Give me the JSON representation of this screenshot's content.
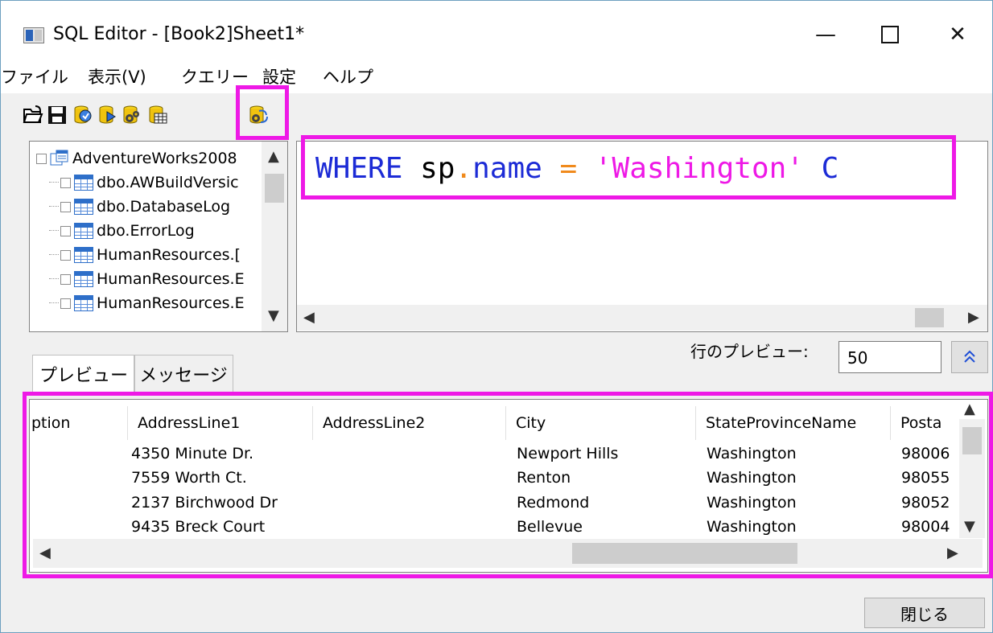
{
  "window": {
    "title": "SQL Editor - [Book2]Sheet1*",
    "minimize_glyph": "—",
    "close_glyph": "✕"
  },
  "menu": [
    "ファイル",
    "表示(V)",
    "クエリー",
    "設定",
    "ヘルプ"
  ],
  "toolbar": {
    "icons": [
      "open-folder-icon",
      "save-icon",
      "query-cylinder-icon",
      "run-query-cylinder-icon",
      "gears-cylinder-icon",
      "table-cylinder-icon",
      "wizard-cylinder-icon"
    ],
    "highlighted_index": 6
  },
  "tree": {
    "root": "AdventureWorks2008",
    "items": [
      "dbo.AWBuildVersic",
      "dbo.DatabaseLog",
      "dbo.ErrorLog",
      "HumanResources.[",
      "HumanResources.E",
      "HumanResources.E"
    ]
  },
  "editor": {
    "keyword": "WHERE",
    "alias": "sp",
    "dot": ".",
    "field": "name",
    "equals": "=",
    "string": "'Washington'",
    "trailing": "C"
  },
  "preview": {
    "label": "行のプレビュー:",
    "rows_value": "50",
    "collapse_glyph": "≈"
  },
  "tabs": [
    "プレビュー",
    "メッセージ"
  ],
  "grid": {
    "columns": [
      "ption",
      "AddressLine1",
      "AddressLine2",
      "City",
      "StateProvinceName",
      "Posta"
    ],
    "rows": [
      [
        "",
        "4350 Minute Dr.",
        "",
        "Newport Hills",
        "Washington",
        "98006"
      ],
      [
        "",
        "7559 Worth Ct.",
        "",
        "Renton",
        "Washington",
        "98055"
      ],
      [
        "",
        "2137 Birchwood Dr",
        "",
        "Redmond",
        "Washington",
        "98052"
      ],
      [
        "",
        "9435 Breck Court",
        "",
        "Bellevue",
        "Washington",
        "98004"
      ]
    ]
  },
  "buttons": {
    "close": "閉じる"
  },
  "colors": {
    "highlight": "#ee19e6",
    "keyword": "#1c2bd6",
    "operator": "#f08a1c",
    "string": "#ee19e6"
  }
}
